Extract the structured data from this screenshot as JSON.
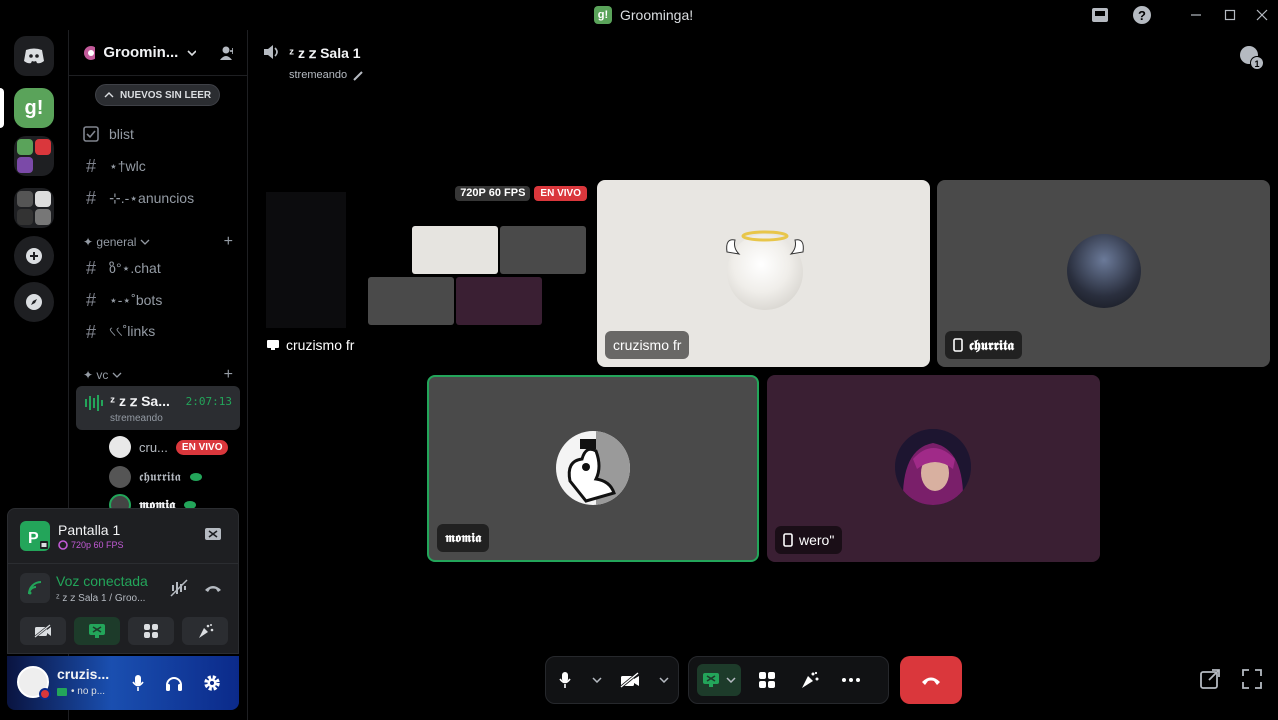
{
  "window": {
    "title": "Groominga!",
    "app_badge": "g!"
  },
  "server": {
    "name": "Groomin...",
    "unread_pill": "NUEVOS SIN LEER"
  },
  "channels_top": [
    {
      "name": "blist",
      "icon": "checklist-icon"
    },
    {
      "name": "⋆†wlc",
      "icon": "hash-icon"
    },
    {
      "name": "⊹.-⋆anuncios",
      "icon": "hash-icon"
    }
  ],
  "category_general": "✦ general",
  "channels_general": [
    {
      "name": "ზ°⋆.chat"
    },
    {
      "name": "⋆-⋆˚bots"
    },
    {
      "name": "৻৻˚links"
    }
  ],
  "category_vc": "✦ vc",
  "voice_channel": {
    "name": "ᶻ z 𝗓 Sa...",
    "status": "stremeando",
    "timer": "2:07:13"
  },
  "voice_users": [
    {
      "name": "cru...",
      "badge": "EN VIVO"
    },
    {
      "name": "𝖈𝖍𝖚𝖗𝖗𝖎𝖙𝖆"
    },
    {
      "name": "𝖒𝖔𝖒𝖎𝖆"
    }
  ],
  "stream_panel": {
    "title": "Pantalla 1",
    "quality": "720p 60 FPS"
  },
  "voice_panel": {
    "status": "Voz conectada",
    "location": "ᶻ z 𝗓 Sala 1 / Groo..."
  },
  "user": {
    "name": "cruzis...",
    "status": "• no p..."
  },
  "call_header": {
    "channel": "ᶻ z 𝗓 Sala 1",
    "status": "stremeando"
  },
  "notif_count": "1",
  "tiles": {
    "stream": {
      "label": "cruzismo fr",
      "quality_badge": "720P 60 FPS",
      "live_badge": "EN VIVO"
    },
    "cruzismo": {
      "label": "cruzismo fr"
    },
    "churrita": {
      "label": "𝖈𝖍𝖚𝖗𝖗𝖎𝖙𝖆"
    },
    "momia": {
      "label": "𝖒𝖔𝖒𝖎𝖆"
    },
    "wero": {
      "label": "wero\""
    }
  },
  "colors": {
    "accent_green": "#23a55a",
    "live_red": "#da373c",
    "bg": "#000000",
    "tile_gray": "#4a4a4a",
    "tile_purple": "#3a1f33"
  }
}
